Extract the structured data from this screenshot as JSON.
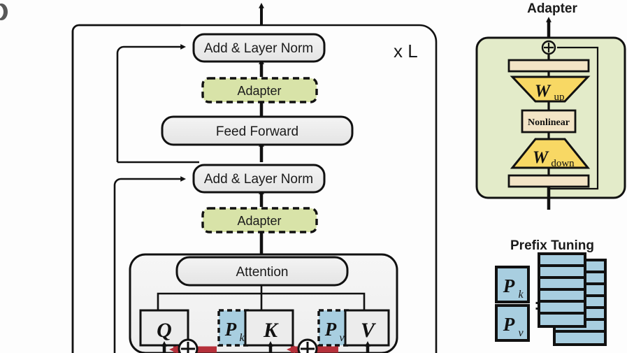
{
  "figure": {
    "corner_mark": "◖",
    "repeat_label": "x L"
  },
  "transformer": {
    "blocks": [
      {
        "id": "add-layer-norm-top",
        "label": "Add & Layer Norm",
        "kind": "rounded-gray"
      },
      {
        "id": "adapter-ffn",
        "label": "Adapter",
        "kind": "dashed-green"
      },
      {
        "id": "feed-forward",
        "label": "Feed Forward",
        "kind": "rounded-gray"
      },
      {
        "id": "add-layer-norm-bottom",
        "label": "Add & Layer Norm",
        "kind": "rounded-gray"
      },
      {
        "id": "adapter-attn",
        "label": "Adapter",
        "kind": "dashed-green"
      },
      {
        "id": "attention",
        "label": "Attention",
        "kind": "rounded-gray"
      }
    ],
    "projections": [
      {
        "id": "q",
        "label": "Q",
        "kind": "square-gray"
      },
      {
        "id": "pk",
        "label": "P",
        "sub": "k",
        "kind": "dashed-blue"
      },
      {
        "id": "k",
        "label": "K",
        "kind": "square-gray"
      },
      {
        "id": "pv",
        "label": "P",
        "sub": "v",
        "kind": "dashed-blue"
      },
      {
        "id": "v",
        "label": "V",
        "kind": "square-gray"
      }
    ],
    "plus_nodes": [
      "⊕",
      "⊕"
    ]
  },
  "adapter_panel": {
    "title": "Adapter",
    "plus_node": "⊕",
    "bars": [
      "",
      ""
    ],
    "w_up": {
      "label": "W",
      "sub": "up"
    },
    "nonlinear": {
      "label": "Nonlinear"
    },
    "w_down": {
      "label": "W",
      "sub": "down"
    }
  },
  "prefix_panel": {
    "title": "Prefix Tuning",
    "pk": {
      "label": "P",
      "sub": "k"
    },
    "pv": {
      "label": "P",
      "sub": "v"
    },
    "separator": ":",
    "front_rows": 6,
    "back_rows": 7
  },
  "colors": {
    "green_fill": "#d8e3a8",
    "green_panel": "#e3ebc9",
    "gray_fill": "#ececec",
    "gray_panel": "#f2f2f2",
    "blue_fill": "#a8cee0",
    "yellow_fill": "#f8d864",
    "cream_fill": "#f3e4c6",
    "stroke": "#111111",
    "red_arrow": "#b5303a"
  }
}
